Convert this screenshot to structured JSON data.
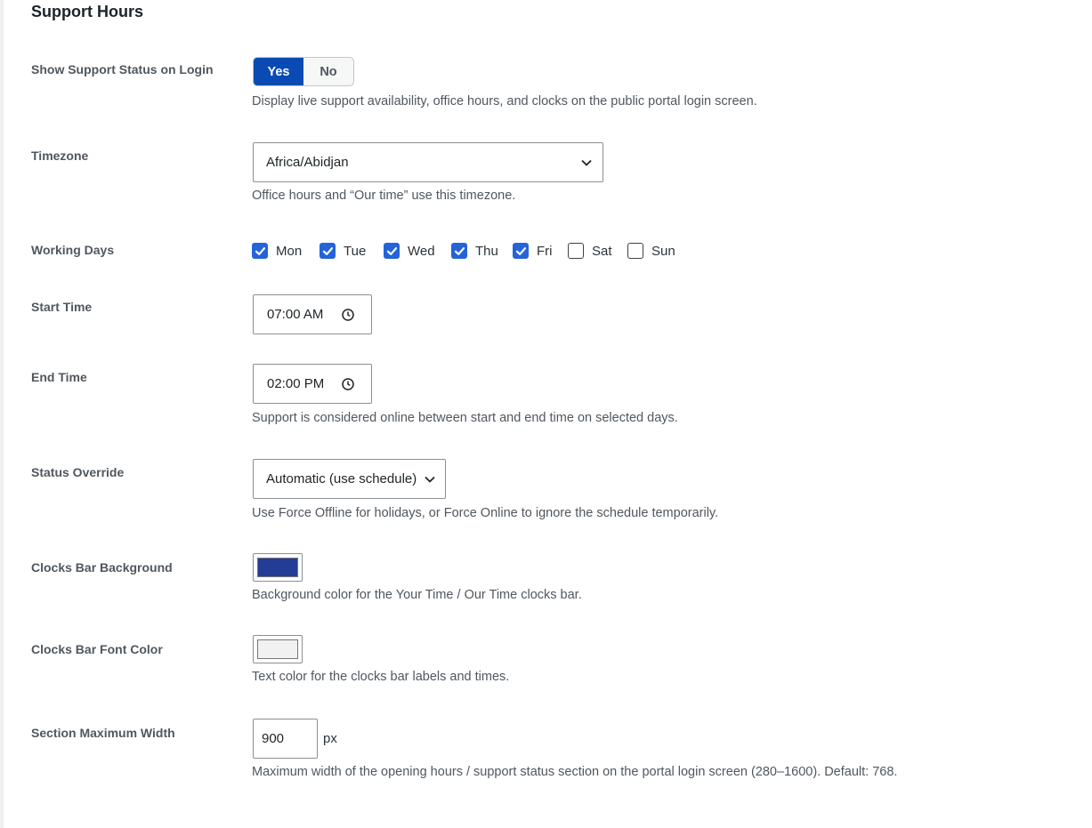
{
  "section": {
    "title": "Support Hours"
  },
  "show_status": {
    "label": "Show Support Status on Login",
    "yes": "Yes",
    "no": "No",
    "selected": "Yes",
    "description": "Display live support availability, office hours, and clocks on the public portal login screen."
  },
  "timezone": {
    "label": "Timezone",
    "value": "Africa/Abidjan",
    "description": "Office hours and “Our time” use this timezone."
  },
  "working_days": {
    "label": "Working Days",
    "days": [
      {
        "label": "Mon",
        "checked": true
      },
      {
        "label": "Tue",
        "checked": true
      },
      {
        "label": "Wed",
        "checked": true
      },
      {
        "label": "Thu",
        "checked": true
      },
      {
        "label": "Fri",
        "checked": true
      },
      {
        "label": "Sat",
        "checked": false
      },
      {
        "label": "Sun",
        "checked": false
      }
    ]
  },
  "start_time": {
    "label": "Start Time",
    "value": "07:00 AM"
  },
  "end_time": {
    "label": "End Time",
    "value": "02:00 PM",
    "description": "Support is considered online between start and end time on selected days."
  },
  "status_override": {
    "label": "Status Override",
    "value": "Automatic (use schedule)",
    "description": "Use Force Offline for holidays, or Force Online to ignore the schedule temporarily."
  },
  "clocks_bg": {
    "label": "Clocks Bar Background",
    "color": "#233d97",
    "description": "Background color for the Your Time / Our Time clocks bar."
  },
  "clocks_font": {
    "label": "Clocks Bar Font Color",
    "color": "#f1f1f1",
    "description": "Text color for the clocks bar labels and times."
  },
  "max_width": {
    "label": "Section Maximum Width",
    "value": "900",
    "unit": "px",
    "description": "Maximum width of the opening hours / support status section on the portal login screen (280–1600). Default: 768."
  },
  "colors": {
    "accent": "#0a4bb3",
    "checkbox": "#2563d8"
  }
}
